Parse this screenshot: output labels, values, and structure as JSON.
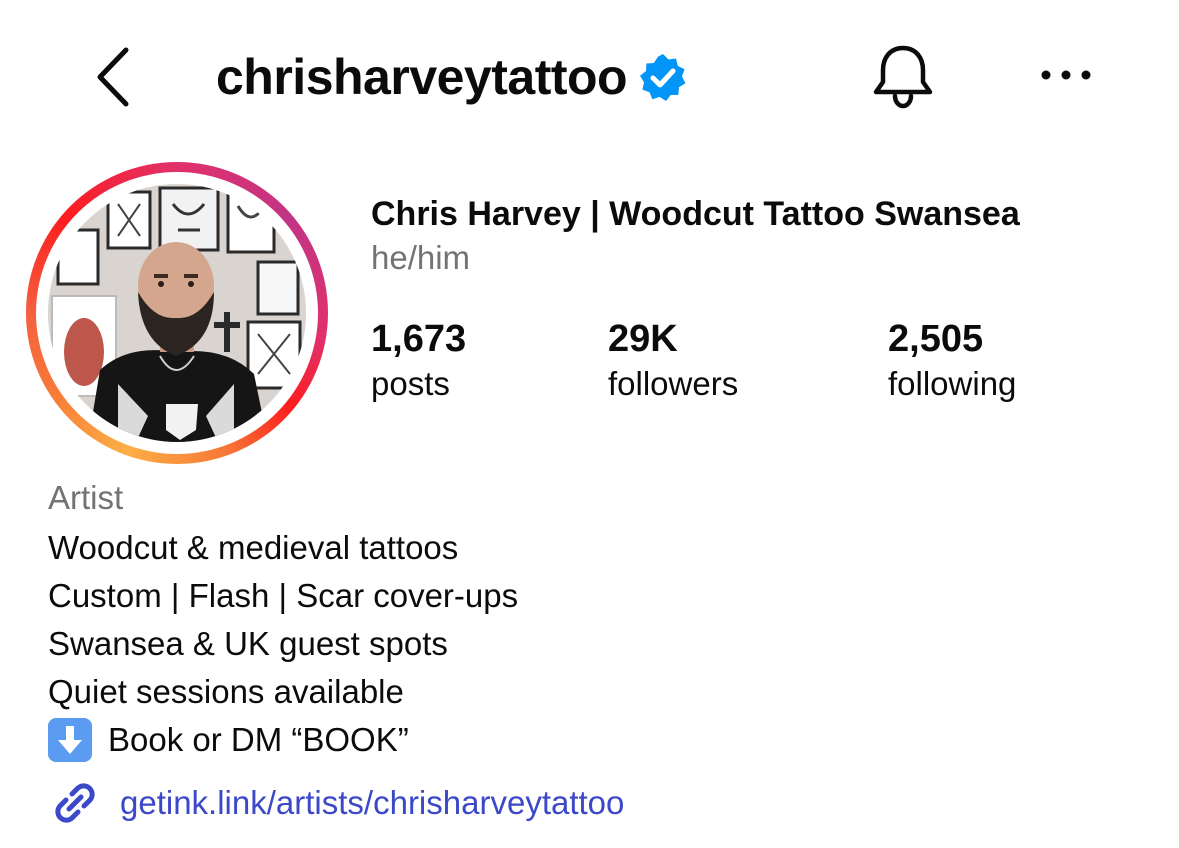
{
  "header": {
    "username": "chrisharveytattoo"
  },
  "profile": {
    "full_name": "Chris Harvey | Woodcut Tattoo Swansea",
    "pronouns": "he/him",
    "stats": {
      "posts": {
        "value": "1,673",
        "label": "posts"
      },
      "followers": {
        "value": "29K",
        "label": "followers"
      },
      "following": {
        "value": "2,505",
        "label": "following"
      }
    },
    "category": "Artist",
    "bio": [
      "Woodcut & medieval tattoos",
      "Custom | Flash | Scar cover-ups",
      "Swansea & UK guest spots",
      "Quiet sessions available",
      "Book or DM “BOOK”"
    ],
    "link": "getink.link/artists/chrisharveytattoo"
  },
  "icons": {
    "back": "chevron-left-icon",
    "verified": "verified-badge-icon",
    "notifications": "bell-icon",
    "more": "more-options-icon",
    "link": "link-icon",
    "book_emoji": "down-arrow-emoji-icon"
  },
  "colors": {
    "verified_blue": "#0095f6",
    "link_blue": "#3b48c8",
    "secondary_text": "#737373",
    "story_ring_start": "#fcaf45",
    "story_ring_end": "#c13584"
  }
}
